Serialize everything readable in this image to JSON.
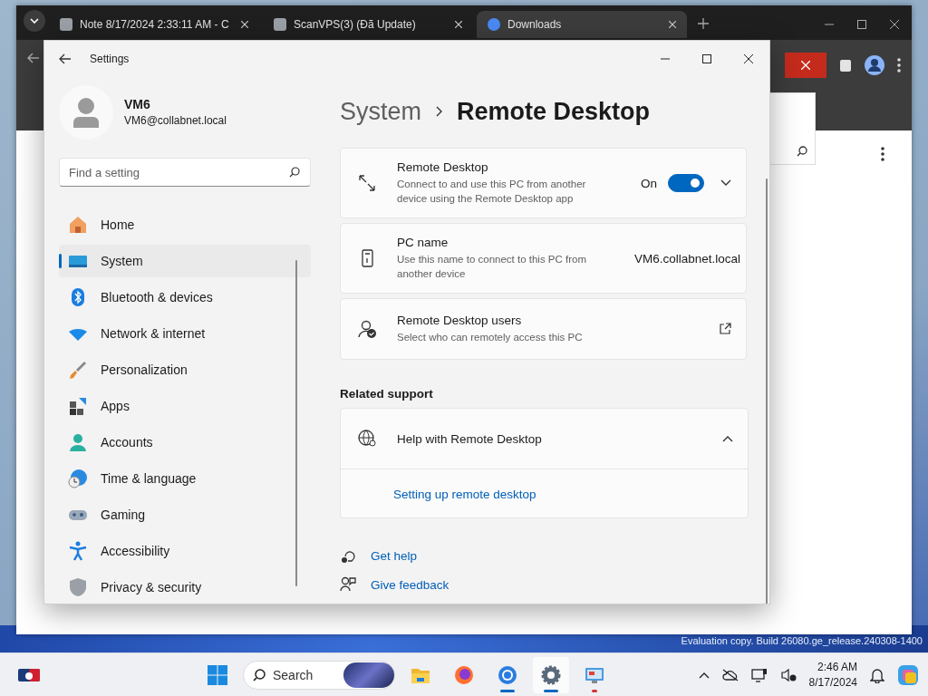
{
  "browser": {
    "tabs": [
      {
        "title": "Note 8/17/2024 2:33:11 AM - C",
        "selected": false
      },
      {
        "title": "ScanVPS(3) (Đã Update)",
        "selected": false
      },
      {
        "title": "Downloads",
        "selected": true
      }
    ]
  },
  "settings": {
    "app_title": "Settings",
    "user": {
      "name": "VM6",
      "email": "VM6@collabnet.local"
    },
    "search": {
      "placeholder": "Find a setting"
    },
    "nav": [
      {
        "label": "Home",
        "selected": false
      },
      {
        "label": "System",
        "selected": true
      },
      {
        "label": "Bluetooth & devices",
        "selected": false
      },
      {
        "label": "Network & internet",
        "selected": false
      },
      {
        "label": "Personalization",
        "selected": false
      },
      {
        "label": "Apps",
        "selected": false
      },
      {
        "label": "Accounts",
        "selected": false
      },
      {
        "label": "Time & language",
        "selected": false
      },
      {
        "label": "Gaming",
        "selected": false
      },
      {
        "label": "Accessibility",
        "selected": false
      },
      {
        "label": "Privacy & security",
        "selected": false
      }
    ],
    "breadcrumb": {
      "parent": "System",
      "current": "Remote Desktop"
    },
    "cards": [
      {
        "kind": "toggle",
        "title": "Remote Desktop",
        "description": "Connect to and use this PC from another device using the Remote Desktop app",
        "state_label": "On",
        "on": true,
        "expanded": false
      },
      {
        "kind": "value",
        "title": "PC name",
        "description": "Use this name to connect to this PC from another device",
        "value": "VM6.collabnet.local"
      },
      {
        "kind": "link",
        "title": "Remote Desktop users",
        "description": "Select who can remotely access this PC"
      }
    ],
    "related": {
      "heading": "Related support",
      "title": "Help with Remote Desktop",
      "expanded": true,
      "links": [
        "Setting up remote desktop"
      ]
    },
    "footer_links": [
      "Get help",
      "Give feedback"
    ]
  },
  "desktop": {
    "build_text": "Evaluation copy. Build 26080.ge_release.240308-1400"
  },
  "taskbar": {
    "search_placeholder": "Search",
    "time": "2:46 AM",
    "date": "8/17/2024",
    "apps": [
      {
        "kind": "files",
        "running": false
      },
      {
        "kind": "firefox",
        "running": false
      },
      {
        "kind": "chrome",
        "running": true
      },
      {
        "kind": "settings",
        "running": true
      },
      {
        "kind": "remote",
        "running": true
      }
    ]
  }
}
